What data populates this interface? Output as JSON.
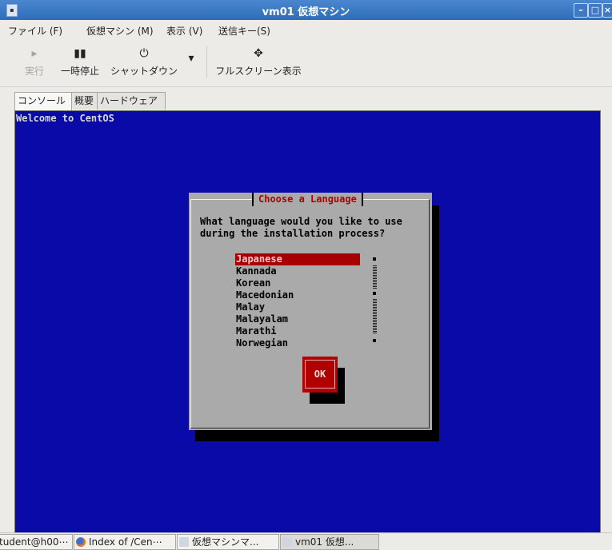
{
  "window": {
    "title": "vm01 仮想マシン",
    "minimize_icon": "minimize-icon",
    "maximize_icon": "maximize-icon",
    "close_icon": "close-icon"
  },
  "menu": {
    "items": [
      "ファイル (F)",
      "仮想マシン (M)",
      "表示 (V)",
      "送信キー(S)"
    ]
  },
  "toolbar": {
    "run_label": "実行",
    "pause_label": "一時停止",
    "shutdown_label": "シャットダウン",
    "fullscreen_label": "フルスクリーン表示"
  },
  "tabs": [
    "コンソール",
    "概要",
    "ハードウェア"
  ],
  "console": {
    "welcome": "Welcome to CentOS",
    "background_color": "#0a0aa8"
  },
  "dialog": {
    "title": "Choose a Language",
    "prompt": "What language would you like to use\nduring the installation process?",
    "languages": [
      "Japanese",
      "Kannada",
      "Korean",
      "Macedonian",
      "Malay",
      "Malayalam",
      "Marathi",
      "Norwegian"
    ],
    "selected": "Japanese",
    "ok_label": "OK"
  },
  "taskbar": {
    "items": [
      "tudent@h00⋯",
      "Index of /Cen⋯",
      "仮想マシンマ...",
      "vm01 仮想..."
    ]
  }
}
